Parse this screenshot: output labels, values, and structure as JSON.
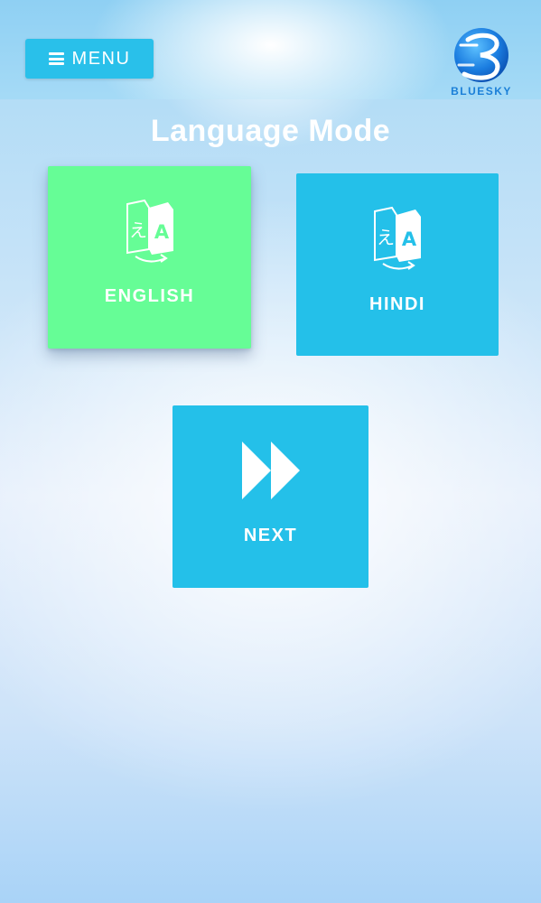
{
  "header": {
    "menu_label": "MENU",
    "logo_text": "BLUESKY"
  },
  "main": {
    "title": "Language Mode",
    "options": [
      {
        "label": "ENGLISH",
        "icon": "translate-icon",
        "selected": true,
        "color": "#66fd96"
      },
      {
        "label": "HINDI",
        "icon": "translate-icon",
        "selected": false,
        "color": "#24c0e9"
      }
    ],
    "next": {
      "label": "NEXT",
      "icon": "fast-forward-icon",
      "color": "#24c0e9"
    }
  },
  "colors": {
    "accent": "#29c0ea",
    "selected": "#66fd96",
    "logo": "#1a7fd8"
  }
}
